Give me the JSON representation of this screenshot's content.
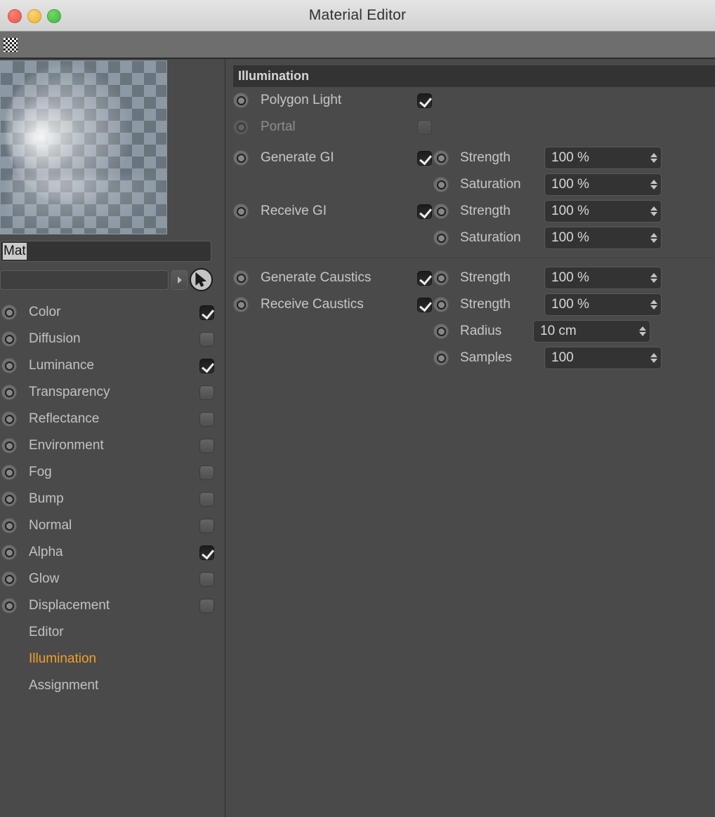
{
  "window": {
    "title": "Material Editor",
    "controls": {
      "close": "close",
      "minimize": "minimize",
      "maximize": "maximize"
    }
  },
  "toolbar": {
    "checker_icon": "checkerboard-icon"
  },
  "left_panel": {
    "preview": {
      "name": "material-preview"
    },
    "material_name": {
      "value": "Mat",
      "placeholder": ""
    },
    "layer_combo": {
      "value": "",
      "placeholder": ""
    },
    "channels": [
      {
        "label": "Color",
        "enabled": true,
        "checked": true,
        "leader": true,
        "bullet": true
      },
      {
        "label": "Diffusion",
        "enabled": true,
        "checked": false,
        "leader": true,
        "bullet": true
      },
      {
        "label": "Luminance",
        "enabled": true,
        "checked": true,
        "leader": true,
        "bullet": true
      },
      {
        "label": "Transparency",
        "enabled": true,
        "checked": false,
        "leader": false,
        "bullet": true
      },
      {
        "label": "Reflectance",
        "enabled": true,
        "checked": false,
        "leader": false,
        "bullet": true
      },
      {
        "label": "Environment",
        "enabled": true,
        "checked": false,
        "leader": false,
        "bullet": true
      },
      {
        "label": "Fog",
        "enabled": true,
        "checked": false,
        "leader": true,
        "bullet": true
      },
      {
        "label": "Bump",
        "enabled": true,
        "checked": false,
        "leader": true,
        "bullet": true
      },
      {
        "label": "Normal",
        "enabled": true,
        "checked": false,
        "leader": true,
        "bullet": true
      },
      {
        "label": "Alpha",
        "enabled": true,
        "checked": true,
        "leader": true,
        "bullet": true
      },
      {
        "label": "Glow",
        "enabled": true,
        "checked": false,
        "leader": true,
        "bullet": true
      },
      {
        "label": "Displacement",
        "enabled": true,
        "checked": false,
        "leader": false,
        "bullet": true
      },
      {
        "label": "Editor",
        "enabled": true,
        "checked": null,
        "leader": true,
        "bullet": false
      },
      {
        "label": "Illumination",
        "enabled": true,
        "checked": null,
        "leader": false,
        "bullet": false,
        "active": true
      },
      {
        "label": "Assignment",
        "enabled": true,
        "checked": null,
        "leader": false,
        "bullet": false
      }
    ]
  },
  "right_panel": {
    "section_title": "Illumination",
    "gi_group": {
      "left": [
        {
          "label": "Polygon Light",
          "checked": true,
          "leader": false,
          "disabled": false
        },
        {
          "label": "Portal",
          "checked": false,
          "leader": true,
          "disabled": true
        },
        {
          "label": "Generate GI",
          "checked": true,
          "leader": true,
          "disabled": false
        },
        {
          "label": "Receive GI",
          "checked": true,
          "leader": true,
          "disabled": false
        }
      ],
      "right": [
        {
          "label": "Strength",
          "value": "100 %",
          "leader": false
        },
        {
          "label": "Saturation",
          "value": "100 %",
          "leader": false
        },
        {
          "label": "Strength",
          "value": "100 %",
          "leader": false
        },
        {
          "label": "Saturation",
          "value": "100 %",
          "leader": false
        }
      ]
    },
    "caustics_group": {
      "left": [
        {
          "label": "Generate Caustics",
          "checked": true,
          "leader": false
        },
        {
          "label": "Receive Caustics",
          "checked": true,
          "leader": false
        }
      ],
      "right": [
        {
          "label": "Strength",
          "value": "100 %",
          "leader": false
        },
        {
          "label": "Strength",
          "value": "100 %",
          "leader": false
        },
        {
          "label": "Radius",
          "value": "10 cm",
          "leader": true
        },
        {
          "label": "Samples",
          "value": "100",
          "leader": false
        }
      ]
    }
  },
  "colors": {
    "window_bg": "#4a4a4a",
    "titlebar": "#dcdcdc",
    "toolbar": "#6e6e6e",
    "section_header": "#333333",
    "field_bg": "#333333",
    "accent_active": "#f0a028",
    "text": "#c7c7c7",
    "close_btn": "#e8564a",
    "min_btn": "#f0b429",
    "max_btn": "#3fb73f"
  }
}
